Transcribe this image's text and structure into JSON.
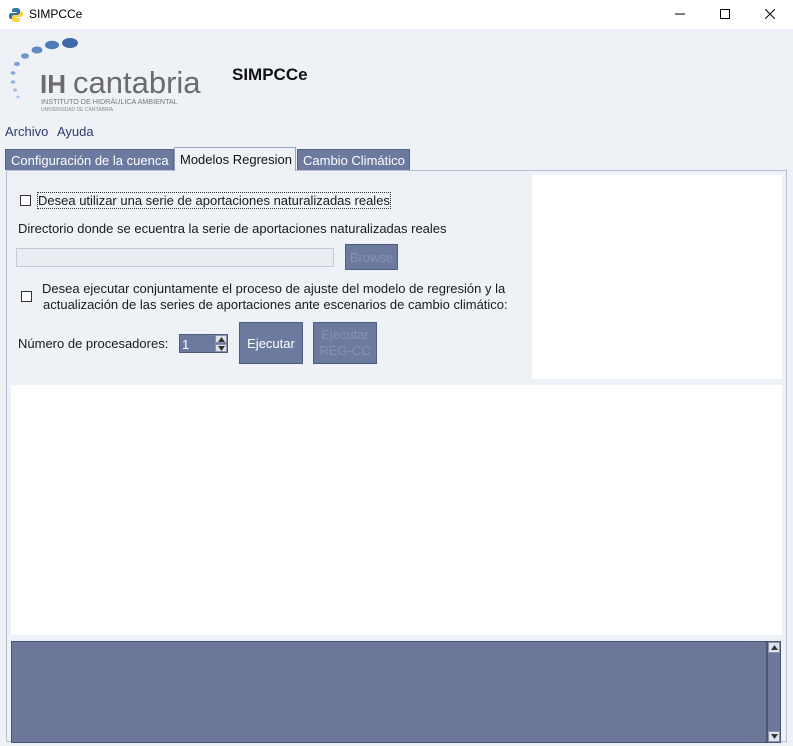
{
  "window": {
    "title": "SIMPCCe",
    "icon": "python-icon"
  },
  "header": {
    "logo_text": "IHcantabria",
    "logo_subtitle": "INSTITUTO DE HIDRÁULICA AMBIENTAL",
    "logo_subtitle2": "UNIVERSIDAD DE CANTABRIA",
    "app_title": "SIMPCCe"
  },
  "menu": {
    "file": "Archivo",
    "help": "Ayuda"
  },
  "tabs": [
    {
      "label": "Configuración de la cuenca",
      "active": false
    },
    {
      "label": "Modelos Regresion",
      "active": true
    },
    {
      "label": "Cambio Climático",
      "active": false
    }
  ],
  "form": {
    "real_series_checkbox_label": "Desea utilizar una serie de aportaciones naturalizadas reales",
    "real_series_checked": false,
    "directory_label": "Directorio donde se ecuentra la serie de aportaciones naturalizadas reales",
    "directory_value": "",
    "browse_label": "Browse",
    "joint_checkbox_label_line1": "Desea ejecutar conjuntamente el proceso de ajuste del modelo de regresión y la",
    "joint_checkbox_label_line2": "actualización de las series de aportaciones ante escenarios de cambio climático:",
    "joint_checked": false,
    "processors_label": "Número de procesadores:",
    "processors_value": "1",
    "run_label": "Ejecutar",
    "run_reg_line1": "Ejecutar",
    "run_reg_line2": "REG-CC"
  },
  "colors": {
    "accent": "#6c7aa0",
    "console_bg": "#6c7799",
    "panel_bg": "#eef2f6"
  }
}
